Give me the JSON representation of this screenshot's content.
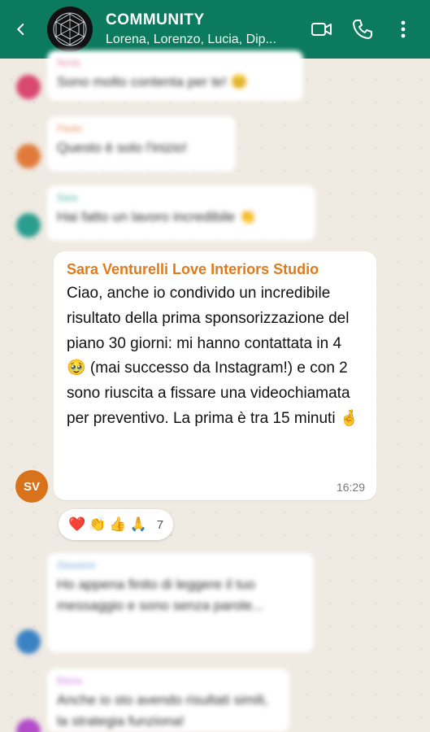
{
  "header": {
    "title": "COMMUNITY",
    "subtitle": "Lorena, Lorenzo, Lucia, Dip..."
  },
  "blurred_messages": [
    {
      "sender": "Ilenia",
      "text": "Sono molto contenta per te! 😊",
      "sender_color": "#e08aa0",
      "avatar_color": "#d9486f"
    },
    {
      "sender": "Paolo",
      "text": "Questo è solo l'inizio!",
      "sender_color": "#e58a5a",
      "avatar_color": "#e07a3a"
    },
    {
      "sender": "Sara",
      "text": "Hai fatto un lavoro incredibile 👏",
      "sender_color": "#4fb3a5",
      "avatar_color": "#2a9d8f"
    },
    {
      "sender": "Giovanni",
      "text": "Ho appena finito di leggere il tuo messaggio e sono senza parole...",
      "sender_color": "#6fa6d6",
      "avatar_color": "#3b82c4"
    },
    {
      "sender": "Elena",
      "text": "Anche io sto avendo risultati simili, la strategia funziona!",
      "sender_color": "#c77bd6",
      "avatar_color": "#b24cc9"
    }
  ],
  "main_message": {
    "sender": "Sara Venturelli Love Interiors Studio",
    "text": "Ciao, anche io condivido un incredibile risultato della prima sponsorizzazione del piano 30 giorni: mi hanno contattata in 4 🥹 (mai successo da Instagram!) e con 2 sono riuscita a fissare una videochiamata per preventivo. La prima è tra 15 minuti 🤞",
    "time": "16:29",
    "avatar_initials": "SV"
  },
  "reactions": {
    "emojis": [
      "❤️",
      "👏",
      "👍",
      "🙏"
    ],
    "count": "7"
  },
  "colors": {
    "header_bg": "#0b7a5f",
    "sender_accent": "#e07a1b"
  }
}
